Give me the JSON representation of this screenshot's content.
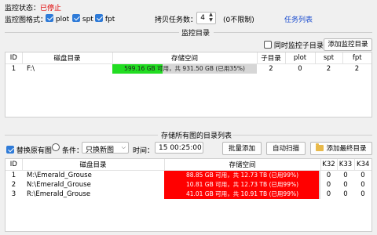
{
  "status": {
    "label": "监控状态：",
    "value": "已停止"
  },
  "format": {
    "label": "监控图格式：",
    "options": [
      {
        "label": "plot",
        "checked": true
      },
      {
        "label": "spt",
        "checked": true
      },
      {
        "label": "fpt",
        "checked": true
      }
    ]
  },
  "copy_tasks": {
    "label": "拷贝任务数：",
    "value": "4",
    "hint": "(0不限制)",
    "task_list_link": "任务列表"
  },
  "monitor_dir": {
    "title": "监控目录",
    "sub_monitor_label": "同时监控子目录",
    "sub_monitor_checked": false,
    "add_button": "添加监控目录",
    "columns": [
      "ID",
      "磁盘目录",
      "存储空间",
      "子目录",
      "plot",
      "spt",
      "fpt"
    ],
    "rows": [
      {
        "id": "1",
        "dir": "F:\\",
        "space_text": "599.16 GB 可用，共 931.50 GB (已用35%)",
        "used_fraction": 0.35,
        "sub": "2",
        "plot": "0",
        "spt": "2",
        "fpt": "2"
      }
    ]
  },
  "storage": {
    "title": "存储所有图的目录列表",
    "replace_label": "替换原有图",
    "replace_checked": true,
    "condition_label": "条件：",
    "condition_value": "只换新图",
    "time_label": "时间：",
    "time_value": "15 00:25:00",
    "batch_add": "批量添加",
    "auto_scan": "自动扫描",
    "add_final": "添加最终目录",
    "columns": [
      "ID",
      "磁盘目录",
      "存储空间",
      "K32",
      "K33",
      "K34"
    ],
    "rows": [
      {
        "id": "1",
        "dir": "M:\\Emerald_Grouse",
        "space_text": "88.85 GB 可用，共 12.73 TB (已用99%)",
        "used_fraction": 0.99,
        "k32": "0",
        "k33": "0",
        "k34": "0"
      },
      {
        "id": "2",
        "dir": "N:\\Emerald_Grouse",
        "space_text": "10.81 GB 可用，共 12.73 TB (已用99%)",
        "used_fraction": 0.99,
        "k32": "0",
        "k33": "0",
        "k34": "0"
      },
      {
        "id": "3",
        "dir": "R:\\Emerald_Grouse",
        "space_text": "41.01 GB 可用，共 10.91 TB (已用99%)",
        "used_fraction": 0.99,
        "k32": "0",
        "k33": "0",
        "k34": "0"
      }
    ]
  },
  "colors": {
    "bar_ok": "#22dd22",
    "bar_full": "#ff0000",
    "bar_bg": "#d6d6d6",
    "stopped": "#e00000",
    "link": "#1a4ccf"
  }
}
